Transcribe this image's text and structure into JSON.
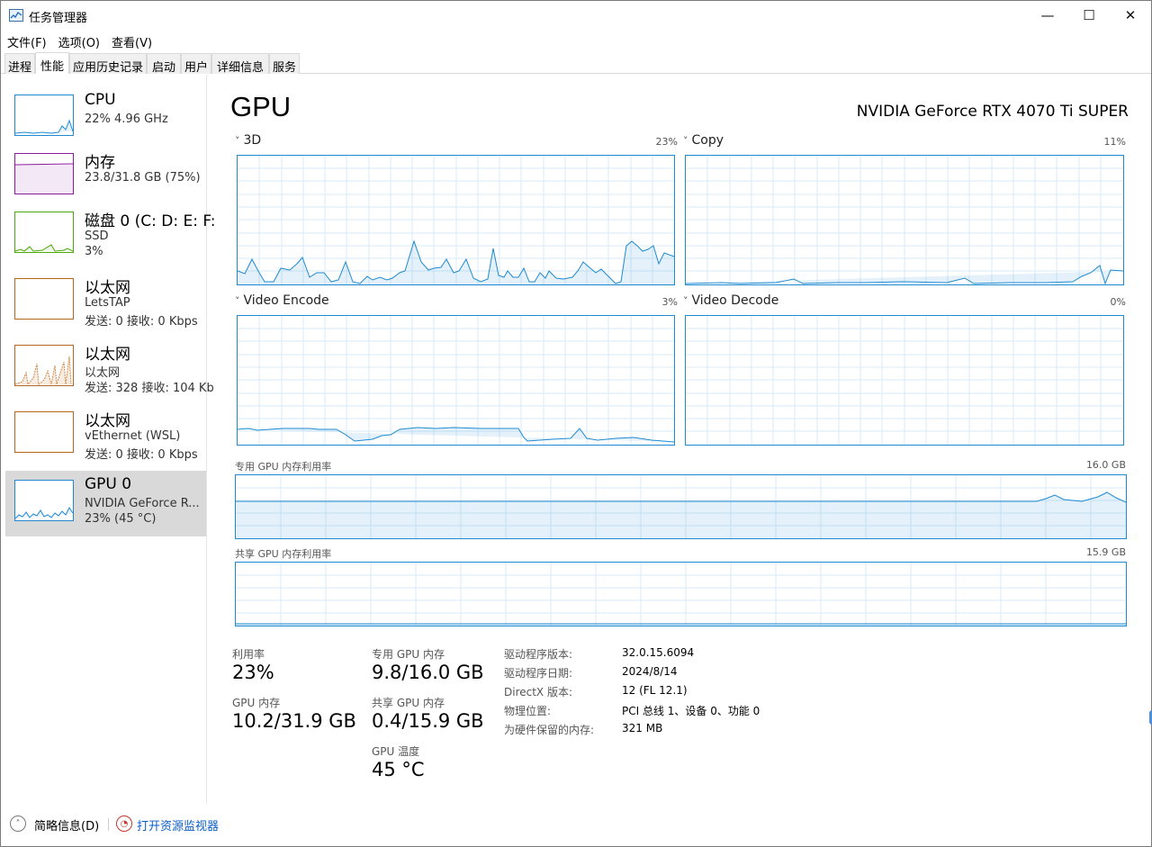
{
  "window": {
    "title": "任务管理器",
    "minimize": "—",
    "maximize": "☐",
    "close": "✕"
  },
  "menu": [
    "文件(F)",
    "选项(O)",
    "查看(V)"
  ],
  "tabs": [
    "进程",
    "性能",
    "应用历史记录",
    "启动",
    "用户",
    "详细信息",
    "服务"
  ],
  "active_tab": 1,
  "sidebar": [
    {
      "title": "CPU",
      "lines": [
        "22% 4.96 GHz"
      ],
      "color": "#1f8ad2"
    },
    {
      "title": "内存",
      "lines": [
        "23.8/31.8 GB (75%)"
      ],
      "color": "#8b1a9c"
    },
    {
      "title": "磁盘 0 (C: D: E: F:",
      "lines": [
        "SSD",
        "3%"
      ],
      "color": "#4ca80c"
    },
    {
      "title": "以太网",
      "lines": [
        "LetsTAP",
        "发送: 0 接收: 0 Kbps"
      ],
      "color": "#b5651d"
    },
    {
      "title": "以太网",
      "lines": [
        "以太网",
        "发送: 328 接收: 104 Kb"
      ],
      "color": "#b5651d"
    },
    {
      "title": "以太网",
      "lines": [
        "vEthernet (WSL)",
        "发送: 0 接收: 0 Kbps"
      ],
      "color": "#b5651d"
    },
    {
      "title": "GPU 0",
      "lines": [
        "NVIDIA GeForce R...",
        "23% (45 °C)"
      ],
      "color": "#1f8ad2"
    }
  ],
  "main": {
    "title": "GPU",
    "model": "NVIDIA GeForce RTX 4070 Ti SUPER",
    "engines": [
      {
        "name": "3D",
        "percent": "23%"
      },
      {
        "name": "Copy",
        "percent": "11%"
      },
      {
        "name": "Video Encode",
        "percent": "3%"
      },
      {
        "name": "Video Decode",
        "percent": "0%"
      }
    ],
    "dedicated_label": "专用 GPU 内存利用率",
    "dedicated_max": "16.0 GB",
    "shared_label": "共享 GPU 内存利用率",
    "shared_max": "15.9 GB"
  },
  "stats": {
    "utilization_label": "利用率",
    "utilization": "23%",
    "gpu_mem_label": "GPU 内存",
    "gpu_mem": "10.2/31.9 GB",
    "dedicated_label": "专用 GPU 内存",
    "dedicated": "9.8/16.0 GB",
    "shared_label": "共享 GPU 内存",
    "shared": "0.4/15.9 GB",
    "temp_label": "GPU 温度",
    "temp": "45 °C"
  },
  "info": [
    {
      "label": "驱动程序版本:",
      "value": "32.0.15.6094"
    },
    {
      "label": "驱动程序日期:",
      "value": "2024/8/14"
    },
    {
      "label": "DirectX 版本:",
      "value": "12 (FL 12.1)"
    },
    {
      "label": "物理位置:",
      "value": "PCI 总线 1、设备 0、功能 0"
    },
    {
      "label": "为硬件保留的内存:",
      "value": "321 MB"
    }
  ],
  "footer": {
    "less_details": "简略信息(D)",
    "resource_monitor": "打开资源监视器"
  }
}
